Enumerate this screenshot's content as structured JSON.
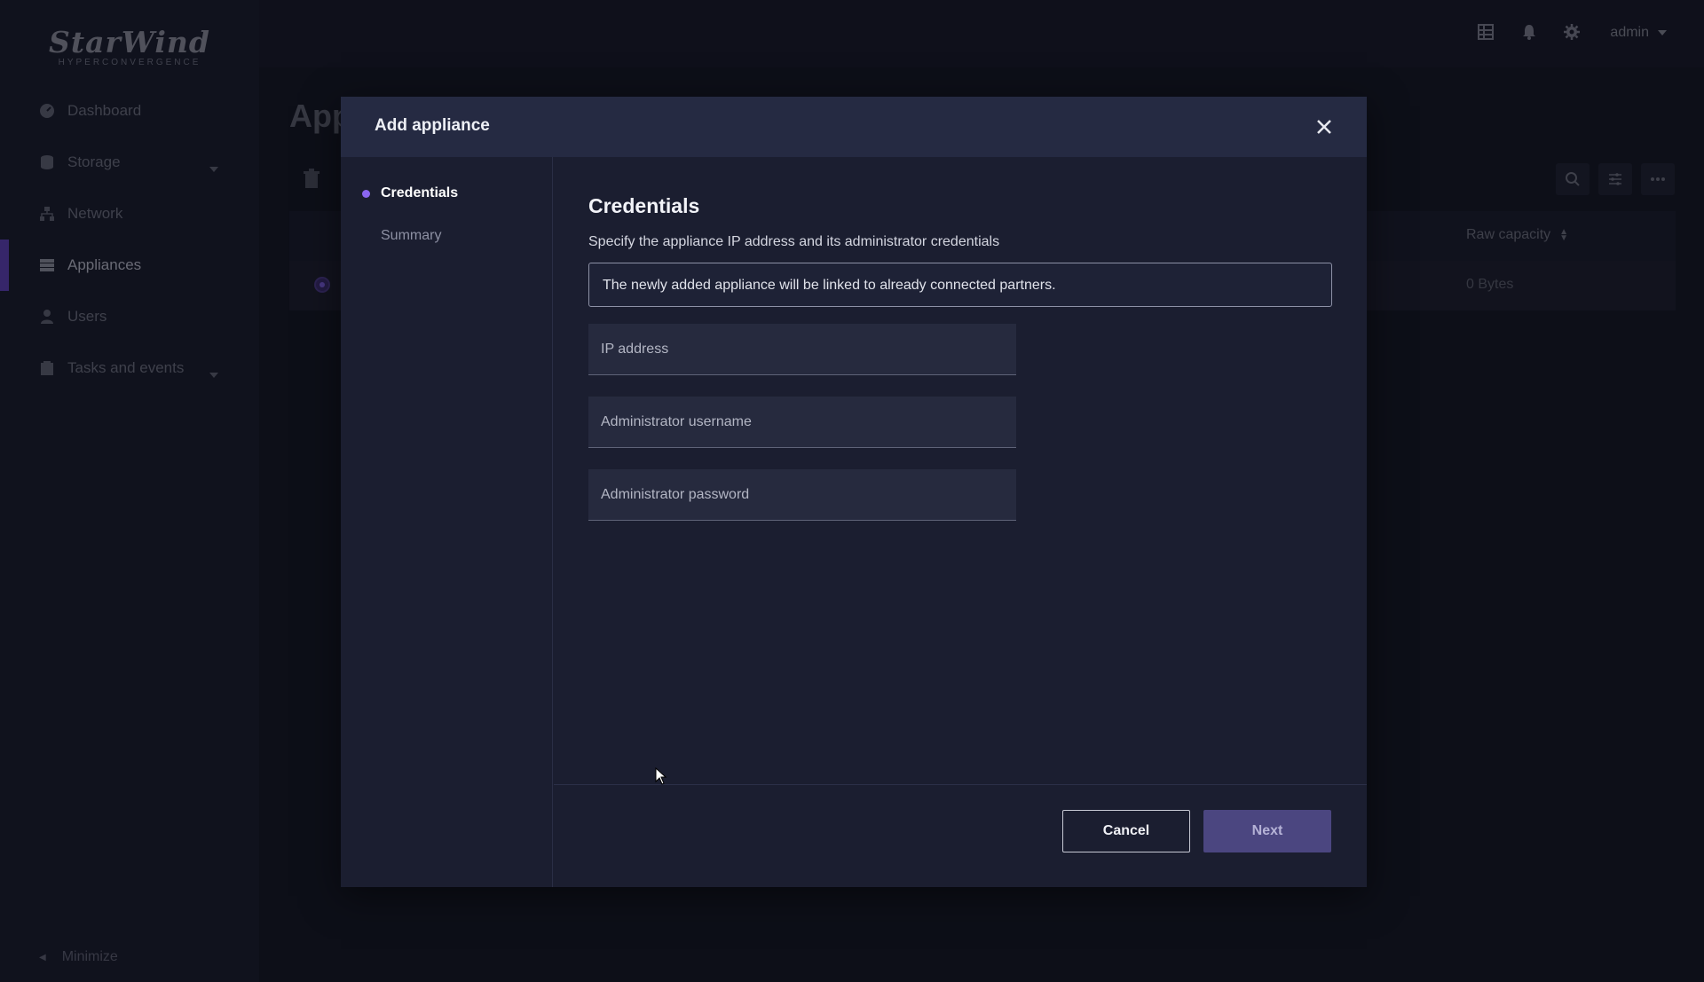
{
  "brand": {
    "name": "StarWind",
    "subtitle": "HYPERCONVERGENCE"
  },
  "sidebar": {
    "items": [
      {
        "label": "Dashboard",
        "icon": "dashboard-icon"
      },
      {
        "label": "Storage",
        "icon": "storage-icon",
        "has_caret": true
      },
      {
        "label": "Network",
        "icon": "network-icon"
      },
      {
        "label": "Appliances",
        "icon": "appliances-icon",
        "active": true
      },
      {
        "label": "Users",
        "icon": "user-icon"
      },
      {
        "label": "Tasks and events",
        "icon": "tasks-icon",
        "has_caret": true
      }
    ],
    "minimize_label": "Minimize"
  },
  "topbar": {
    "user_label": "admin"
  },
  "page": {
    "title": "App",
    "table": {
      "column_raw_capacity": "Raw capacity",
      "row_raw_capacity": "0 Bytes"
    }
  },
  "modal": {
    "title": "Add appliance",
    "steps": [
      {
        "label": "Credentials",
        "active": true
      },
      {
        "label": "Summary",
        "active": false
      }
    ],
    "section_title": "Credentials",
    "description": "Specify the appliance IP address and its administrator credentials",
    "notice": "The newly added appliance will be linked to already connected partners.",
    "fields": {
      "ip_placeholder": "IP address",
      "username_placeholder": "Administrator username",
      "password_placeholder": "Administrator password"
    },
    "buttons": {
      "cancel": "Cancel",
      "next": "Next"
    }
  },
  "colors": {
    "accent": "#8a66f0",
    "next_button": "#4b4680",
    "modal_header": "#252a42"
  }
}
